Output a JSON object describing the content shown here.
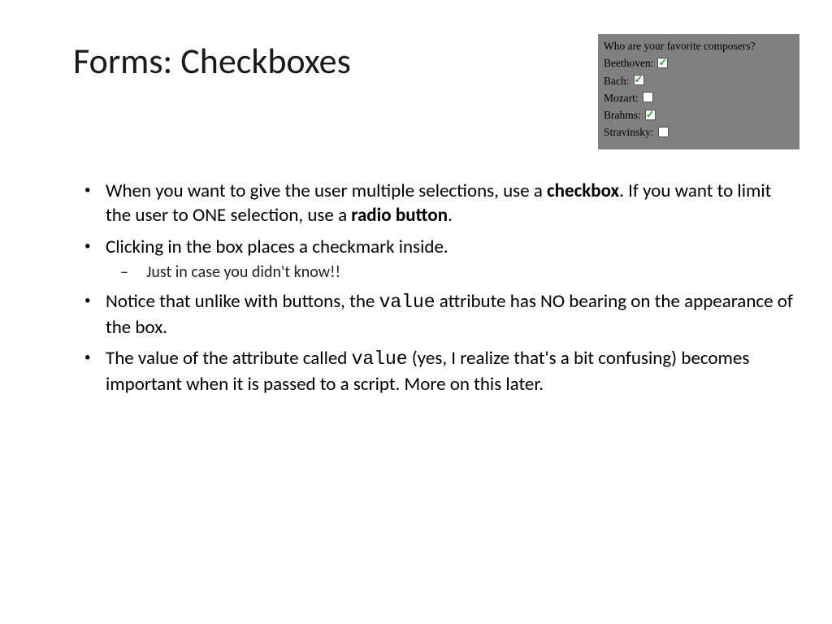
{
  "title": "Forms: Checkboxes",
  "form": {
    "question": "Who are your favorite composers?",
    "items": [
      {
        "label": "Beethoven:",
        "checked": true
      },
      {
        "label": "Bach:",
        "checked": true
      },
      {
        "label": "Mozart:",
        "checked": false
      },
      {
        "label": "Brahms:",
        "checked": true
      },
      {
        "label": "Stravinsky:",
        "checked": false
      }
    ]
  },
  "bullets": {
    "b1a": "When you want to give the user multiple selections, use a ",
    "b1b": "checkbox",
    "b1c": ". If you want to limit the user to ONE selection, use a ",
    "b1d": "radio button",
    "b1e": ".",
    "b2": "Clicking in the box places a checkmark inside.",
    "b2s": "Just in case you didn't know!!",
    "b3a": "Notice that unlike with buttons, the ",
    "b3b": "value",
    "b3c": " attribute has NO bearing on the appearance of the box.",
    "b4a": "The value of the attribute called ",
    "b4b": "value",
    "b4c": "  (yes, I realize that's a bit confusing) becomes important when it is passed to a script. More on this later."
  }
}
